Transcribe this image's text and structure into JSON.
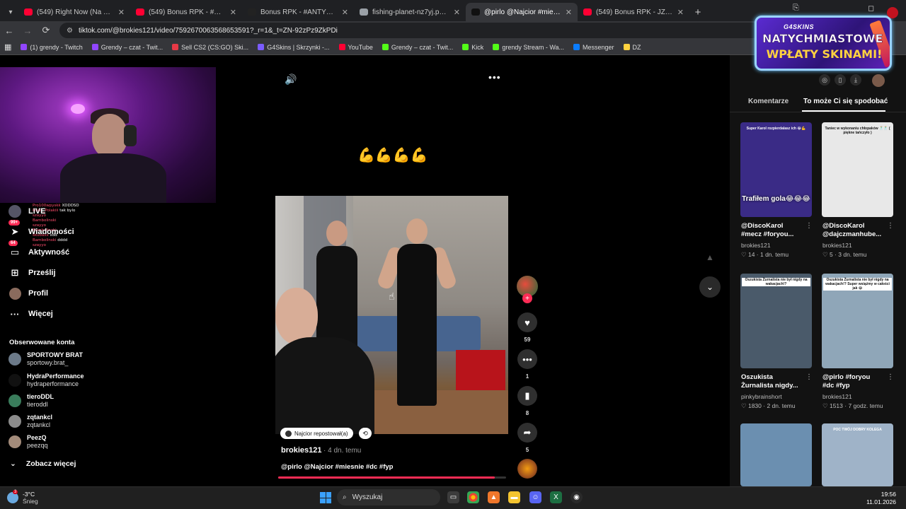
{
  "browser": {
    "tabs": [
      {
        "title": "(549) Right Now (Na Na Na) - Y",
        "color": "#ff0033",
        "active": false
      },
      {
        "title": "(549) Bonus RPK - #ANTYGRAN",
        "color": "#ff0033",
        "active": false
      },
      {
        "title": "Bonus RPK - #ANTYGRANDE L",
        "color": "#222222",
        "active": false
      },
      {
        "title": "fishing-planet-nz7yj.png (480×",
        "color": "#9aa0a6",
        "active": false
      },
      {
        "title": "@pirlo @Najcior #miesnie #dc",
        "color": "#111111",
        "active": true
      },
      {
        "title": "(549) Bonus RPK - JZWWZJ ft. I",
        "color": "#ff0033",
        "active": false
      }
    ],
    "url": "tiktok.com/@brokies121/video/7592670063568653591?_r=1&_t=ZN-92zPz9ZkPDi",
    "bookmarks": [
      {
        "label": "(1) grendy - Twitch",
        "color": "#9146ff"
      },
      {
        "label": "Grendy – czat - Twit...",
        "color": "#9146ff"
      },
      {
        "label": "Sell CS2 (CS:GO) Ski...",
        "color": "#e63946"
      },
      {
        "label": "G4Skins | Skrzynki -...",
        "color": "#7b5cff"
      },
      {
        "label": "YouTube",
        "color": "#ff0033"
      },
      {
        "label": "Grendy – czat - Twit...",
        "color": "#53fc18"
      },
      {
        "label": "Kick",
        "color": "#53fc18"
      },
      {
        "label": "grendy Stream - Wa...",
        "color": "#53fc18"
      },
      {
        "label": "Messenger",
        "color": "#0a7cff"
      },
      {
        "label": "DZ",
        "color": "#ffd23f"
      }
    ]
  },
  "stream_chat": [
    {
      "user": "Pro100wpyskk",
      "msg": "XDDDSD"
    },
    {
      "user": "Polak_Polakiii",
      "msg": "tak bylo"
    },
    {
      "user": "szayyo",
      "msg": ""
    },
    {
      "user": "Bambolinski",
      "msg": ""
    },
    {
      "user": "szayyo",
      "msg": ""
    },
    {
      "user": "Bambolinski",
      "msg": ""
    },
    {
      "user": "skubaxx",
      "msg": "xdd"
    },
    {
      "user": "Bambolinski",
      "msg": "dddd"
    },
    {
      "user": "szayyo",
      "msg": ""
    }
  ],
  "left_nav": {
    "items": [
      {
        "label": "LIVE",
        "icon": "live-icon",
        "badge": ""
      },
      {
        "label": "Wiadomości",
        "icon": "send-icon",
        "badge": "99+"
      },
      {
        "label": "Aktywność",
        "icon": "inbox-icon",
        "badge": "64"
      },
      {
        "label": "Prześlij",
        "icon": "upload-icon",
        "badge": ""
      },
      {
        "label": "Profil",
        "icon": "profile-avatar",
        "badge": ""
      },
      {
        "label": "Więcej",
        "icon": "more-icon",
        "badge": ""
      }
    ],
    "followed_heading": "Obserwowane konta",
    "followed": [
      {
        "name": "SPORTOWY BRAT",
        "handle": "sportowy.brat_",
        "color": "#6c7a89"
      },
      {
        "name": "HydraPerformance",
        "handle": "hydraperformance",
        "color": "#111111"
      },
      {
        "name": "tieroDDL",
        "handle": "tieroddl",
        "color": "#3a7d5c"
      },
      {
        "name": "zqtankcl",
        "handle": "zqtankcl",
        "color": "#8c8c8c"
      },
      {
        "name": "PeezQ",
        "handle": "peezqq",
        "color": "#a38b7a"
      }
    ],
    "see_more": "Zobacz więcej"
  },
  "video": {
    "emoji_caption": "💪💪💪💪",
    "repost_label": "Najcior repostował(a)",
    "author": "brokies121",
    "date": "· 4 dn. temu",
    "caption": "@pirlo @Najcior #miesnie #dc #fyp",
    "progress": 0.95,
    "likes": "59",
    "comments": "1",
    "saves": "8",
    "shares": "5"
  },
  "right_panel": {
    "tabs": [
      "Komentarze",
      "To może Ci się spodobać"
    ],
    "active_tab": 1,
    "cards": [
      {
        "handle": "@DiscoKarol",
        "title": "#mecz #foryou...",
        "author": "brokies121",
        "meta": "♡ 14 · 1 dn. temu",
        "thumb_top": "Super Karol rozpierdalasz ich 😂💪",
        "thumb_big": "Trafiłem gola😂😂😂",
        "bg": "#3a2b86"
      },
      {
        "handle": "@DiscoKarol",
        "title": "@dajczmanhube...",
        "author": "brokies121",
        "meta": "♡ 5 · 3 dn. temu",
        "thumb_top": "Taniec w wykonaniu chłopaków 🕺🕺 ( piękne tańczyło )",
        "thumb_big": "",
        "bg": "#e8e8e8"
      },
      {
        "handle": "Oszukista",
        "title": "Żurnalista nigdy...",
        "author": "pinkybrainshort",
        "meta": "♡ 1830 · 2 dn. temu",
        "thumb_top": "Oszukista Żurnalista nie był nigdy na wakacjach!?",
        "thumb_big": "",
        "bg": "#4a5a6a"
      },
      {
        "handle": "@pirlo #foryou",
        "title": "#dc #fyp",
        "author": "brokies121",
        "meta": "♡ 1513 · 7 godz. temu",
        "thumb_top": "Oszukista Żurnalista nie był nigdy na wakacjach!? Super wsiąźmy w całości jak 😂",
        "thumb_big": "",
        "bg": "#8fa6b8"
      },
      {
        "handle": "",
        "title": "",
        "author": "",
        "meta": "",
        "thumb_top": "",
        "thumb_big": "",
        "bg": "#6b8fb0"
      },
      {
        "handle": "",
        "title": "",
        "author": "",
        "meta": "",
        "thumb_top": "POC TWÓJ DOBRY KOLEGA",
        "thumb_big": "",
        "bg": "#9fb3c8"
      }
    ]
  },
  "promo": {
    "brand": "G4SKINS",
    "line1": "NATYCHMIASTOWE",
    "line2": "WPŁATY SKINAMI!"
  },
  "taskbar": {
    "temp": "-3°C",
    "weather": "Śnieg",
    "weather_badge": "3",
    "search_placeholder": "Wyszukaj",
    "time": "19:56",
    "date": "11.01.2026"
  }
}
